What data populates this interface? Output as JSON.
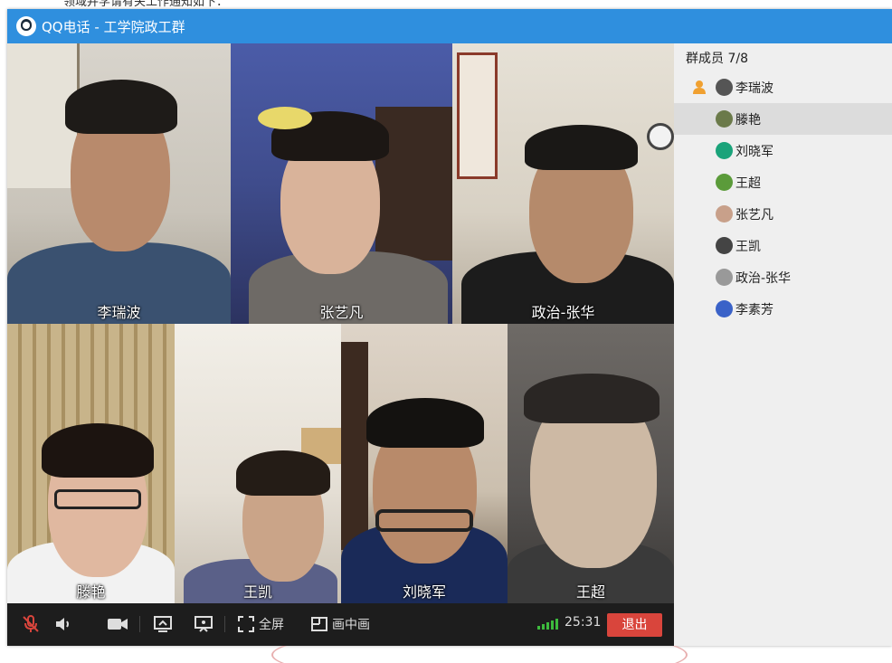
{
  "window": {
    "app_name": "QQ电话",
    "separator": "-",
    "group_name": "工学院政工群"
  },
  "background_doc": {
    "text_fragment": "领域并学请有关工作通知如下："
  },
  "video_tiles": [
    {
      "name": "李瑞波"
    },
    {
      "name": "张艺凡"
    },
    {
      "name": "政治-张华"
    },
    {
      "name": "滕艳"
    },
    {
      "name": "王凯"
    },
    {
      "name": "刘晓军"
    },
    {
      "name": "王超"
    }
  ],
  "controls": {
    "fullscreen_label": "全屏",
    "pip_label": "画中画",
    "timer": "25:31",
    "exit_label": "退出",
    "signal_bars": 5
  },
  "members": {
    "header": "群成员 7/8",
    "items": [
      {
        "name": "李瑞波",
        "is_owner": true,
        "avatar_color": "#555555"
      },
      {
        "name": "滕艳",
        "selected": true,
        "avatar_color": "#6b7a4a"
      },
      {
        "name": "刘晓军",
        "avatar_color": "#1aa37a"
      },
      {
        "name": "王超",
        "avatar_color": "#5b9b3a"
      },
      {
        "name": "张艺凡",
        "avatar_color": "#c8a08a"
      },
      {
        "name": "王凯",
        "avatar_color": "#444444"
      },
      {
        "name": "政治-张华",
        "avatar_color": "#999999"
      },
      {
        "name": "李素芳",
        "avatar_color": "#3a62c8"
      }
    ]
  },
  "colors": {
    "titlebar": "#2f8fde",
    "exit_button": "#d9453c",
    "signal": "#3dbb3d"
  }
}
